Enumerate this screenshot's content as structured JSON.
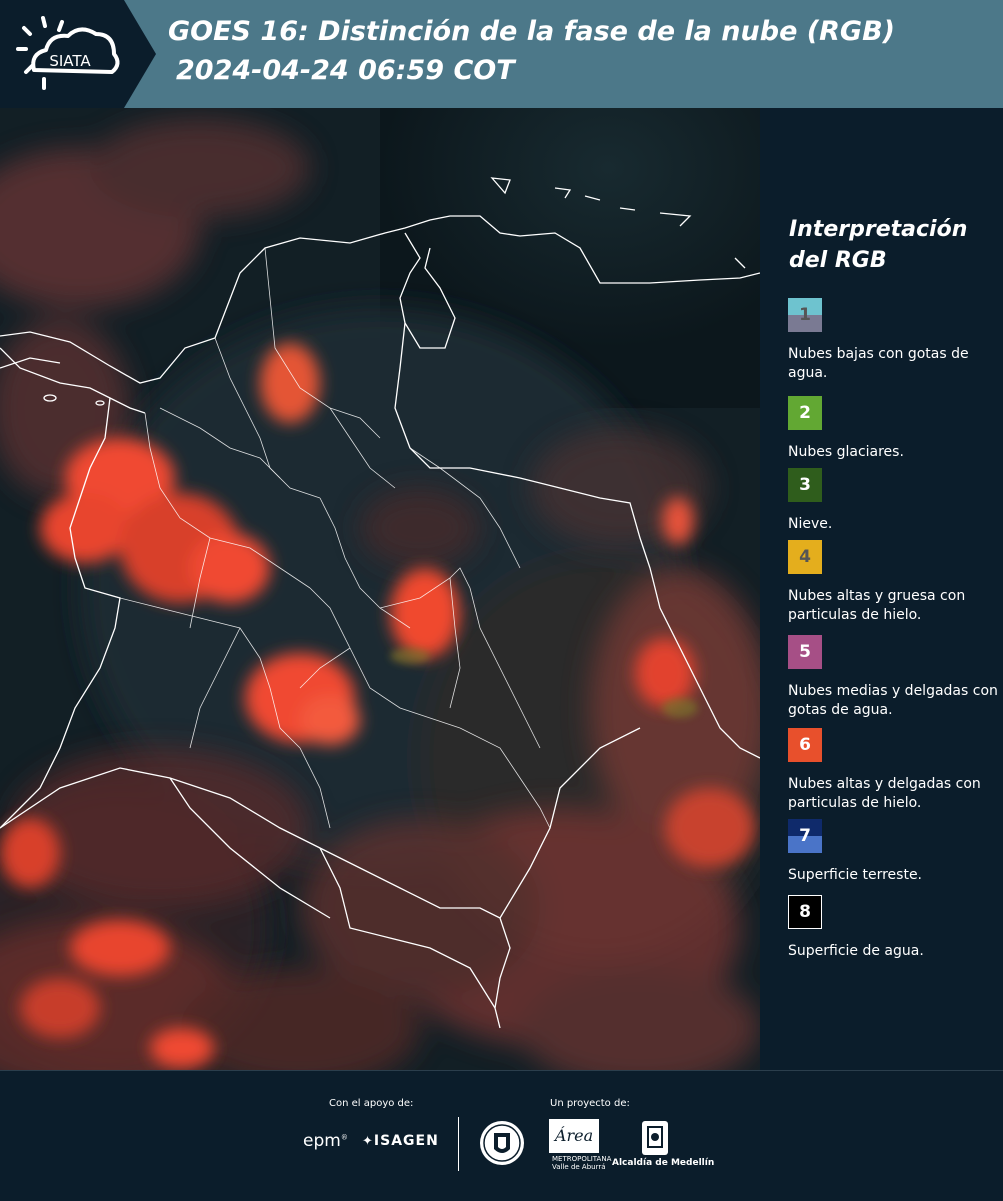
{
  "header": {
    "brand": "SIATA",
    "title_line1": "GOES 16: Distinción de la fase de la nube (RGB)",
    "title_line2": "2024-04-24 06:59 COT"
  },
  "legend": {
    "title": "Interpretación del RGB",
    "items": [
      {
        "number": "1",
        "label": "Nubes bajas con gotas de agua.",
        "color_top": "#6ec3cf",
        "color_bottom": "#7a7a93",
        "text_color": "#555555"
      },
      {
        "number": "2",
        "label": "Nubes glaciares.",
        "color": "#62a833",
        "text_color": "#ffffff"
      },
      {
        "number": "3",
        "label": "Nieve.",
        "color": "#2f5d1c",
        "text_color": "#ffffff"
      },
      {
        "number": "4",
        "label": "Nubes altas y gruesa con particulas de hielo.",
        "color": "#e4ae1d",
        "text_color": "#555555"
      },
      {
        "number": "5",
        "label": "Nubes medias y delgadas con gotas de agua.",
        "color": "#a64f86",
        "text_color": "#ffffff"
      },
      {
        "number": "6",
        "label": "Nubes altas y delgadas con particulas de hielo.",
        "color": "#e8502c",
        "text_color": "#ffffff"
      },
      {
        "number": "7",
        "label": "Superficie terreste.",
        "color_top": "#0f2a6b",
        "color_bottom": "#4a74c8",
        "text_color": "#ffffff"
      },
      {
        "number": "8",
        "label": "Superficie de agua.",
        "color": "#000000",
        "text_color": "#ffffff",
        "border": "#ffffff"
      }
    ]
  },
  "footer": {
    "support_caption": "Con el apoyo de:",
    "project_caption": "Un proyecto de:",
    "epm": "epm",
    "isagen": "ISAGEN",
    "area": "Área",
    "area_subtitle": "METROPOLITANA Valle de Aburrá",
    "alcaldia": "Alcaldía de Medellín"
  },
  "colors": {
    "header_bg": "#4c7889",
    "panel_bg": "#0b1d2b",
    "cloud_red": "#f04a30"
  }
}
